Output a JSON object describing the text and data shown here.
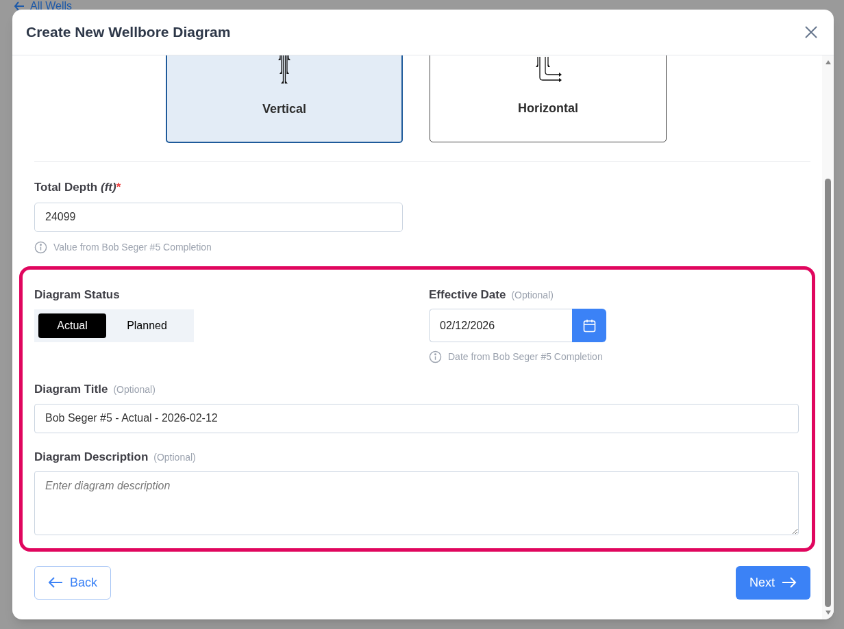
{
  "background": {
    "back_link": "All Wells"
  },
  "dialog": {
    "title": "Create New Wellbore Diagram",
    "well_types": [
      {
        "kind": "vertical",
        "label": "Vertical",
        "selected": true
      },
      {
        "kind": "horizontal",
        "label": "Horizontal",
        "selected": false
      }
    ],
    "total_depth": {
      "label": "Total Depth",
      "unit": "(ft)",
      "required_mark": "*",
      "value": "24099",
      "hint": "Value from Bob Seger #5 Completion"
    },
    "diagram_status": {
      "label": "Diagram Status",
      "options": [
        {
          "label": "Actual",
          "selected": true
        },
        {
          "label": "Planned",
          "selected": false
        }
      ]
    },
    "effective_date": {
      "label": "Effective Date",
      "optional": "(Optional)",
      "value": "02/12/2026",
      "hint": "Date from Bob Seger #5 Completion"
    },
    "diagram_title": {
      "label": "Diagram Title",
      "optional": "(Optional)",
      "value": "Bob Seger #5 - Actual - 2026-02-12"
    },
    "diagram_description": {
      "label": "Diagram Description",
      "optional": "(Optional)",
      "placeholder": "Enter diagram description"
    },
    "buttons": {
      "back": "Back",
      "next": "Next"
    }
  }
}
